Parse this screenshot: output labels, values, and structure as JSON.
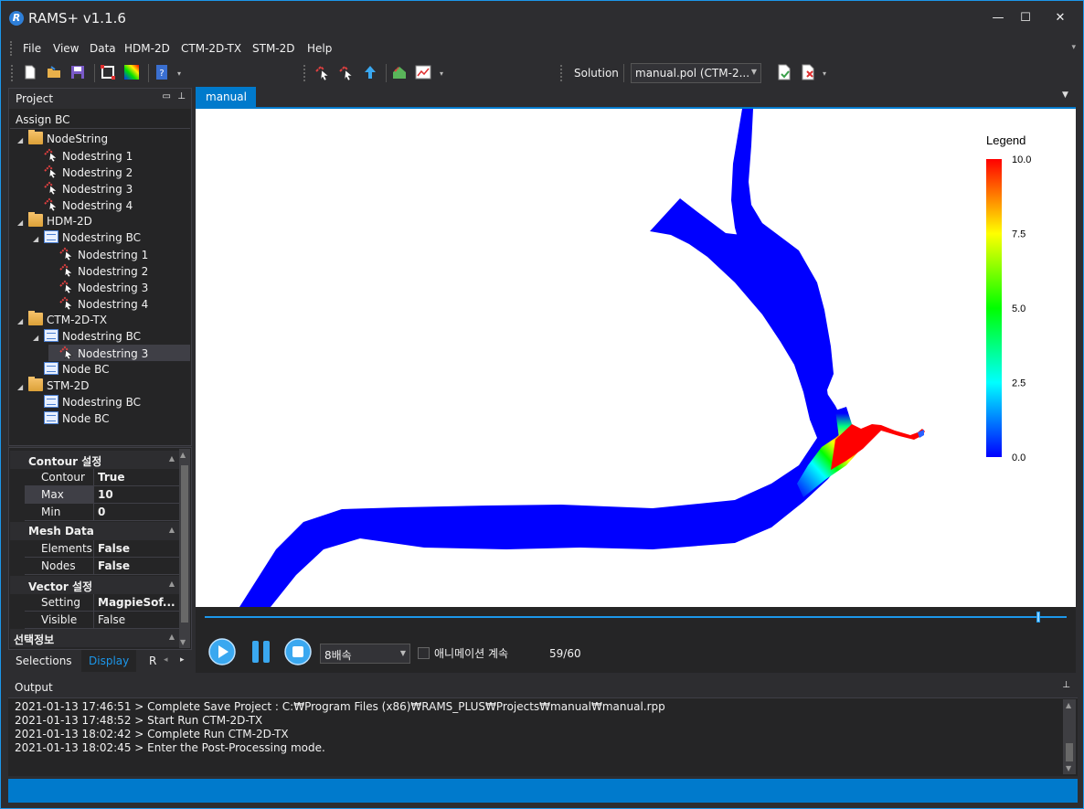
{
  "window": {
    "title": "RAMS+ v1.1.6",
    "logo_letter": "R",
    "minimize": "—",
    "maximize": "☐",
    "close": "✕"
  },
  "menu": [
    "File",
    "View",
    "Data",
    "HDM-2D",
    "CTM-2D-TX",
    "STM-2D",
    "Help"
  ],
  "toolbar": {
    "solution_label": "Solution",
    "solution_value": "manual.pol (CTM-2..."
  },
  "project": {
    "header": "Project",
    "subheader": "Assign BC",
    "tree": [
      {
        "label": "NodeString",
        "icon": "folder-icon",
        "expander": "◢"
      },
      {
        "label": "Nodestring 1",
        "icon": "nodestring-icon"
      },
      {
        "label": "Nodestring 2",
        "icon": "nodestring-icon"
      },
      {
        "label": "Nodestring 3",
        "icon": "nodestring-icon"
      },
      {
        "label": "Nodestring 4",
        "icon": "nodestring-icon"
      },
      {
        "label": "HDM-2D",
        "icon": "folder-icon",
        "expander": "◢"
      },
      {
        "label": "Nodestring BC",
        "icon": "bc-list-icon",
        "expander": "◢"
      },
      {
        "label": "Nodestring 1",
        "icon": "nodestring-icon"
      },
      {
        "label": "Nodestring 2",
        "icon": "nodestring-icon"
      },
      {
        "label": "Nodestring 3",
        "icon": "nodestring-icon"
      },
      {
        "label": "Nodestring 4",
        "icon": "nodestring-icon"
      },
      {
        "label": "CTM-2D-TX",
        "icon": "folder-icon",
        "expander": "◢"
      },
      {
        "label": "Nodestring BC",
        "icon": "bc-list-icon",
        "expander": "◢"
      },
      {
        "label": "Nodestring 3",
        "icon": "nodestring-icon",
        "selected": true
      },
      {
        "label": "Node BC",
        "icon": "bc-list-icon"
      },
      {
        "label": "STM-2D",
        "icon": "folder-icon",
        "expander": "◢"
      },
      {
        "label": "Nodestring BC",
        "icon": "bc-list-icon"
      },
      {
        "label": "Node BC",
        "icon": "bc-list-icon"
      }
    ]
  },
  "properties": {
    "contour_category": "Contour 설정",
    "contour_key": "Contour",
    "contour_value": "True",
    "max_key": "Max",
    "max_value": "10",
    "min_key": "Min",
    "min_value": "0",
    "mesh_category": "Mesh Data",
    "elements_key": "Elements",
    "elements_value": "False",
    "nodes_key": "Nodes",
    "nodes_value": "False",
    "vector_category": "Vector 설정",
    "setting_key": "Setting",
    "setting_value": "MagpieSof...",
    "visible_key": "Visible",
    "visible_value": "False",
    "selection_category": "선택정보"
  },
  "bottom_tabs": {
    "selections": "Selections",
    "display": "Display",
    "r": "R"
  },
  "document": {
    "tab": "manual"
  },
  "legend": {
    "title": "Legend",
    "ticks": [
      "10.0",
      "7.5",
      "5.0",
      "2.5",
      "0.0"
    ],
    "colors": [
      "#ff0000",
      "#ffff00",
      "#00ff00",
      "#00ffff",
      "#0000ff"
    ]
  },
  "player": {
    "speed": "8배속",
    "loop_label": "애니메이션 계속",
    "frame": "59/60",
    "progress": 0.983
  },
  "output": {
    "header": "Output",
    "lines": [
      "2021-01-13 17:46:51 > Complete Save Project : C:₩Program Files (x86)₩RAMS_PLUS₩Projects₩manual₩manual.rpp",
      "2021-01-13 17:48:52 > Start Run CTM-2D-TX",
      "2021-01-13 18:02:42 > Complete Run CTM-2D-TX",
      "2021-01-13 18:02:45 > Enter the Post-Processing mode."
    ]
  }
}
